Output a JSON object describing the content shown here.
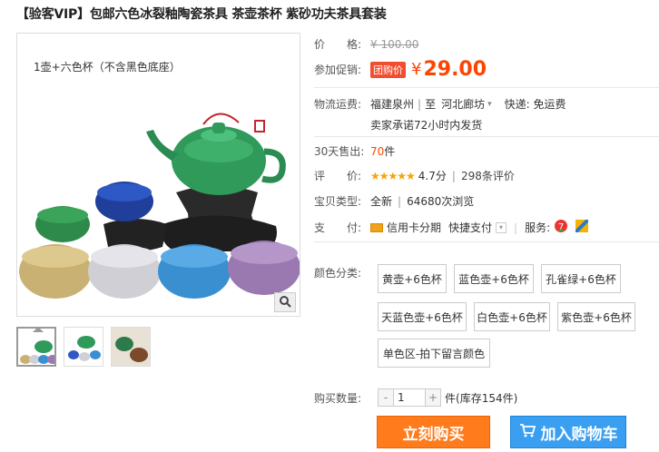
{
  "product": {
    "title": "【验客VIP】包邮六色冰裂釉陶瓷茶具 茶壶茶杯 紫砂功夫茶具套装",
    "image_caption": "1壶+六色杯（不含黑色底座）"
  },
  "price": {
    "label": "价　　格:",
    "original": "¥ 100.00"
  },
  "promo": {
    "label": "参加促销:",
    "badge": "团购价",
    "currency": "¥",
    "value": "29.00"
  },
  "shipping": {
    "label": "物流运费:",
    "from": "福建泉州",
    "separator": "|",
    "to_prefix": "至",
    "to": "河北廊坊",
    "fee": "快递: 免运费",
    "promise": "卖家承诺72小时内发货"
  },
  "sales": {
    "label": "30天售出:",
    "count": "70",
    "unit": "件"
  },
  "rating": {
    "label": "评　　价:",
    "stars": "★★★★★",
    "score": "4.7分",
    "reviews": "298条评价"
  },
  "type": {
    "label": "宝贝类型:",
    "value": "全新",
    "views": "64680次浏览"
  },
  "payment": {
    "label": "支　　付:",
    "credit": "信用卡分期",
    "quick": "快捷支付",
    "service_label": "服务:"
  },
  "colors": {
    "label": "颜色分类:",
    "options": [
      "黄壶+6色杯",
      "蓝色壶+6色杯",
      "孔雀绿+6色杯",
      "天蓝色壶+6色杯",
      "白色壶+6色杯",
      "紫色壶+6色杯",
      "单色区-拍下留言颜色"
    ]
  },
  "quantity": {
    "label": "购买数量:",
    "minus": "-",
    "value": "1",
    "plus": "+",
    "unit": "件",
    "stock": "(库存154件)"
  },
  "actions": {
    "buy": "立刻购买",
    "cart": "加入购物车"
  },
  "colors_hex": {
    "accent": "#ff4400",
    "buy_button": "#ff7b1c",
    "cart_button": "#3a9ff0"
  }
}
